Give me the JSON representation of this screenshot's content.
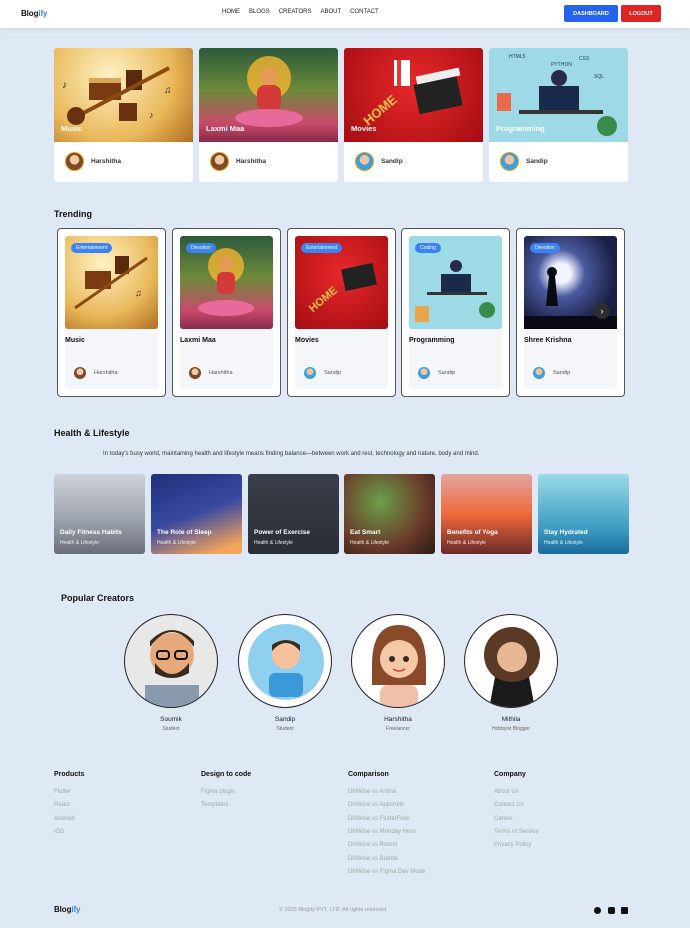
{
  "brand": {
    "prefix": "Blog",
    "suffix": "ify"
  },
  "nav": {
    "links": [
      "HOME",
      "BLOGS",
      "CREATORS",
      "ABOUT",
      "CONTACT"
    ],
    "dashboard": "DASHBOARD",
    "logout": "LOGOUT"
  },
  "featured": [
    {
      "caption": "Music",
      "author": "Harshitha"
    },
    {
      "caption": "Laxmi Maa",
      "author": "Harshitha"
    },
    {
      "caption": "Movies",
      "author": "Sandip"
    },
    {
      "caption": "Programming",
      "author": "Sandip"
    }
  ],
  "trending": {
    "title": "Trending",
    "items": [
      {
        "tag": "Entertainment",
        "title": "Music",
        "author": "Harshitha"
      },
      {
        "tag": "Devotion",
        "title": "Laxmi Maa",
        "author": "Harshitha"
      },
      {
        "tag": "Entertainment",
        "title": "Movies",
        "author": "Sandip"
      },
      {
        "tag": "Coding",
        "title": "Programming",
        "author": "Sandip"
      },
      {
        "tag": "Devotion",
        "title": "Shree Krishna",
        "author": "Sandip"
      }
    ]
  },
  "health": {
    "title": "Health & Lifestyle",
    "description": "In today's busy world, maintaining health and lifestyle means finding balance—between work and rest, technology and nature, body and mind.",
    "items": [
      {
        "title": "Daily Fitness Habits",
        "sub": "Health & Lifestyle"
      },
      {
        "title": "The Role of Sleep",
        "sub": "Health & Lifestyle"
      },
      {
        "title": "Power of Exercise",
        "sub": "Health & Lifestyle"
      },
      {
        "title": "Eat Smart",
        "sub": "Health & Lifestyle"
      },
      {
        "title": "Benefits of Yoga",
        "sub": "Health & Lifestyle"
      },
      {
        "title": "Stay Hydrated",
        "sub": "Health & Lifestyle"
      }
    ]
  },
  "creators": {
    "title": "Popular Creators",
    "items": [
      {
        "name": "Soumik",
        "role": "Student"
      },
      {
        "name": "Sandip",
        "role": "Student"
      },
      {
        "name": "Harshitha",
        "role": "Freelancer"
      },
      {
        "name": "Mithila",
        "role": "Hobbyist Blogger"
      }
    ]
  },
  "footer": {
    "columns": [
      {
        "title": "Products",
        "links": [
          "Flutter",
          "React",
          "Android",
          "iOS"
        ]
      },
      {
        "title": "Design to code",
        "links": [
          "Figma plugin",
          "Templates"
        ]
      },
      {
        "title": "Comparison",
        "links": [
          "DhiWise vs Anima",
          "DhiWise vs Appsmith",
          "DhiWise vs FlutterFlow",
          "DhiWise vs Monday Hero",
          "DhiWise vs Retool",
          "DhiWise vs Bubble",
          "DhiWise vs Figma Dev Mode"
        ]
      },
      {
        "title": "Company",
        "links": [
          "About Us",
          "Contact Us",
          "Career",
          "Terms of Service",
          "Privacy Policy"
        ]
      }
    ],
    "copyright": "© 2025 Blogify PVT. LTD. All rights reserved"
  }
}
